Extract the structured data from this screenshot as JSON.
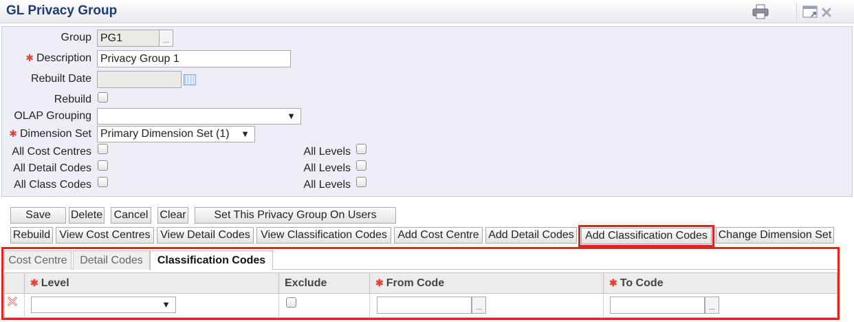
{
  "title": "GL Privacy Group",
  "toolbar": {
    "print_icon": "printer-icon",
    "popout_icon": "window-popout-icon",
    "close_icon": "close-icon"
  },
  "form": {
    "group_label": "Group",
    "group_value": "PG1",
    "description_label": "Description",
    "description_value": "Privacy Group 1",
    "rebuilt_date_label": "Rebuilt Date",
    "rebuilt_date_value": "",
    "rebuild_label": "Rebuild",
    "olap_label": "OLAP Grouping",
    "olap_value": "",
    "dimension_label": "Dimension Set",
    "dimension_value": "Primary Dimension Set (1)",
    "all_cost_centres_label": "All Cost Centres",
    "all_detail_codes_label": "All Detail Codes",
    "all_class_codes_label": "All Class Codes",
    "all_levels_label": "All Levels",
    "ellipsis": "..."
  },
  "buttons_row1": {
    "save": "Save",
    "delete": "Delete",
    "cancel": "Cancel",
    "clear": "Clear",
    "set_on_users": "Set This Privacy Group On Users"
  },
  "buttons_row2": {
    "rebuild": "Rebuild",
    "view_cost_centres": "View Cost Centres",
    "view_detail_codes": "View Detail Codes",
    "view_classification_codes": "View Classification Codes",
    "add_cost_centre": "Add Cost Centre",
    "add_detail_codes": "Add Detail Codes",
    "add_classification_codes": "Add Classification Codes",
    "change_dimension_set": "Change Dimension Set"
  },
  "tabs": [
    {
      "label": "Cost Centre",
      "active": false
    },
    {
      "label": "Detail Codes",
      "active": false
    },
    {
      "label": "Classification Codes",
      "active": true
    }
  ],
  "grid": {
    "headers": [
      "Level",
      "Exclude",
      "From Code",
      "To Code"
    ],
    "row": {
      "level": "",
      "from_code": "",
      "to_code": ""
    }
  },
  "colors": {
    "title": "#1f3a7a",
    "highlight": "#e02424",
    "required": "#e0413a",
    "panel": "#eeeef8"
  }
}
